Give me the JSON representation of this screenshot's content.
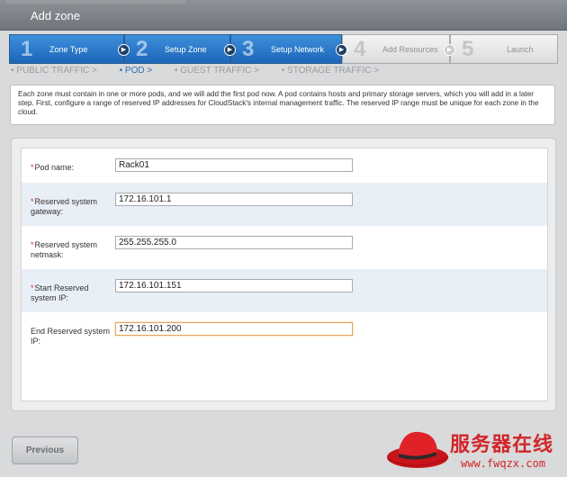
{
  "window": {
    "title": "Add zone"
  },
  "steps": [
    {
      "num": "1",
      "label": "Zone Type",
      "state": "active"
    },
    {
      "num": "2",
      "label": "Setup Zone",
      "state": "active"
    },
    {
      "num": "3",
      "label": "Setup Network",
      "state": "active"
    },
    {
      "num": "4",
      "label": "Add Resources",
      "state": "inactive"
    },
    {
      "num": "5",
      "label": "Launch",
      "state": "inactive"
    }
  ],
  "subnav": [
    {
      "label": "• PUBLIC TRAFFIC  >",
      "current": false
    },
    {
      "label": "• POD  >",
      "current": true
    },
    {
      "label": "• GUEST TRAFFIC  >",
      "current": false
    },
    {
      "label": "• STORAGE TRAFFIC  >",
      "current": false
    }
  ],
  "description": "Each zone must contain in one or more pods, and we will add the first pod now. A pod contains hosts and primary storage servers, which you will add in a later step. First, configure a range of reserved IP addresses for CloudStack's internal management traffic. The reserved IP range must be unique for each zone in the cloud.",
  "form": {
    "pod_name": {
      "label": "Pod name:",
      "required": true,
      "value": "Rack01"
    },
    "gateway": {
      "label": "Reserved system gateway:",
      "required": true,
      "value": "172.16.101.1"
    },
    "netmask": {
      "label": "Reserved system netmask:",
      "required": true,
      "value": "255.255.255.0"
    },
    "start_ip": {
      "label": "Start Reserved system IP:",
      "required": true,
      "value": "172.16.101.151"
    },
    "end_ip": {
      "label": "End Reserved system IP:",
      "required": false,
      "value": "172.16.101.200"
    }
  },
  "buttons": {
    "previous": "Previous"
  },
  "watermark": {
    "text": "服务器在线",
    "url": "www.fwqzx.com"
  },
  "colors": {
    "accent": "#1d66b8",
    "required": "#e0322e",
    "brand": "#d2262a"
  }
}
